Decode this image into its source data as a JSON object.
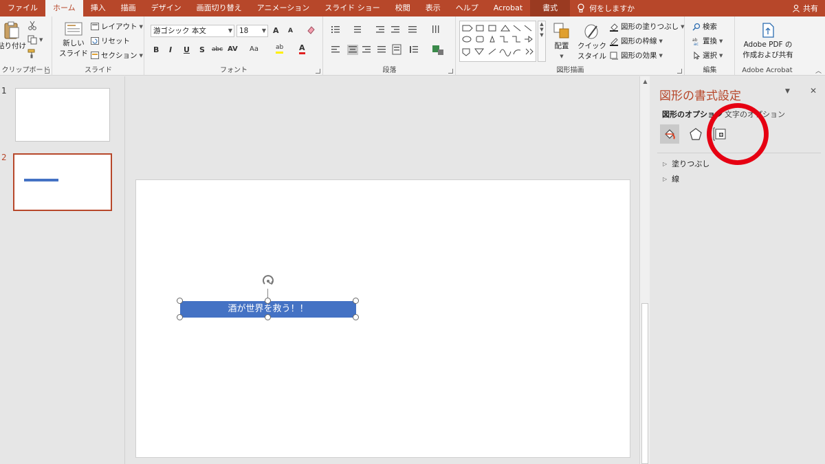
{
  "tabs": [
    "ファイル",
    "ホーム",
    "挿入",
    "描画",
    "デザイン",
    "画面切り替え",
    "アニメーション",
    "スライド ショー",
    "校閲",
    "表示",
    "ヘルプ",
    "Acrobat"
  ],
  "active_tab": "ホーム",
  "context_tab": "書式",
  "tell_me": "何をしますか",
  "share": "共有",
  "ribbon": {
    "clipboard": {
      "label": "クリップボード",
      "paste": "貼り付け"
    },
    "slides": {
      "label": "スライド",
      "new_slide_1": "新しい",
      "new_slide_2": "スライド",
      "layout": "レイアウト",
      "reset": "リセット",
      "section": "セクション"
    },
    "font": {
      "label": "フォント",
      "font_name": "游ゴシック 本文",
      "font_size": "18",
      "bold": "B",
      "italic": "I",
      "underline": "U",
      "shadow": "S",
      "strike": "abc",
      "spacing": "AV",
      "case": "Aa",
      "highlight": "ab",
      "color": "A",
      "grow": "A",
      "shrink": "A"
    },
    "paragraph": {
      "label": "段落"
    },
    "drawing": {
      "label": "図形描画",
      "arrange": "配置",
      "quick_style_1": "クイック",
      "quick_style_2": "スタイル",
      "shape_fill": "図形の塗りつぶし",
      "shape_outline": "図形の枠線",
      "shape_effects": "図形の効果"
    },
    "editing": {
      "label": "編集",
      "find": "検索",
      "replace": "置換",
      "select": "選択"
    },
    "acrobat": {
      "label": "Adobe Acrobat",
      "create_1": "Adobe PDF の",
      "create_2": "作成および共有"
    }
  },
  "thumbnails": [
    {
      "number": "1",
      "selected": false
    },
    {
      "number": "2",
      "selected": true
    }
  ],
  "slide": {
    "textbox_text": "酒が世界を救う！！",
    "shape_color": "#4472c4"
  },
  "format_pane": {
    "title": "図形の書式設定",
    "tab_shape_options": "図形のオプション",
    "tab_text_options": "文字のオプション",
    "sections": [
      "塗りつぶし",
      "線"
    ]
  },
  "colors": {
    "accent": "#b7472a",
    "annotation": "#e60012"
  }
}
